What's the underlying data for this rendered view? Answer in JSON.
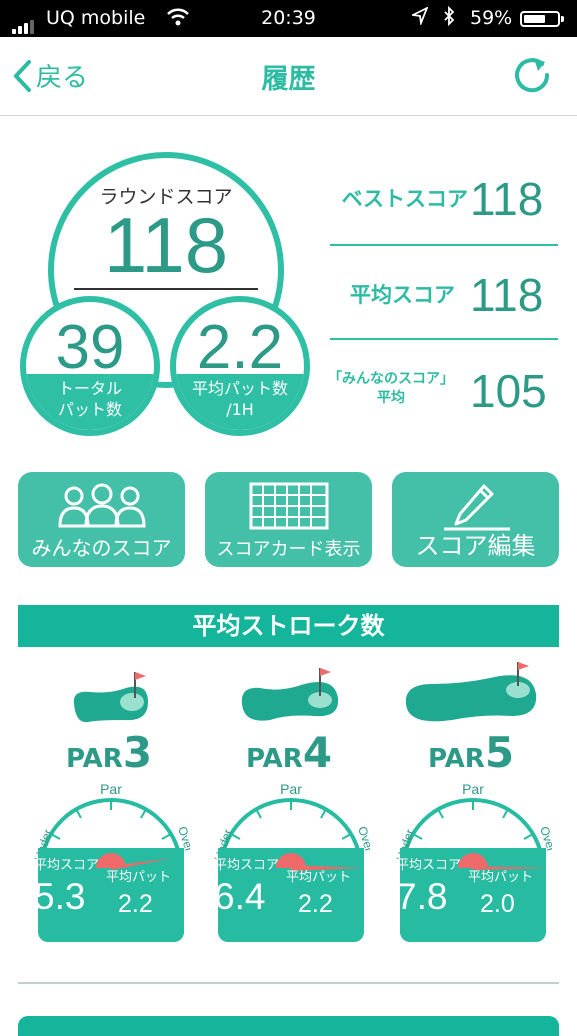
{
  "status_bar": {
    "carrier": "UQ mobile",
    "time": "20:39",
    "battery": "59%",
    "battery_level": 0.59
  },
  "nav": {
    "back_label": "戻る",
    "title": "履歴"
  },
  "round": {
    "label": "ラウンドスコア",
    "value": "118",
    "total_putts_value": "39",
    "total_putts_label_1": "トータル",
    "total_putts_label_2": "パット数",
    "avg_putts_value": "2.2",
    "avg_putts_label_1": "平均パット数",
    "avg_putts_label_2": "/1H"
  },
  "stats": {
    "best_label": "ベストスコア",
    "best_value": "118",
    "avg_label": "平均スコア",
    "avg_value": "118",
    "everyone_label_1": "「みんなのスコア」",
    "everyone_label_2": "平均",
    "everyone_value": "105"
  },
  "actions": {
    "everyone_scores": "みんなのスコア",
    "scorecard": "スコアカード表示",
    "edit_score": "スコア編集"
  },
  "section_title": "平均ストローク数",
  "pars": [
    {
      "par_text": "PAR",
      "par_num": "3",
      "gauge_top": "Par",
      "gauge_left": "Under",
      "gauge_right": "Over",
      "avg_score_label": "平均スコア",
      "avg_score": "5.3",
      "avg_putt_label": "平均パット",
      "avg_putt": "2.2"
    },
    {
      "par_text": "PAR",
      "par_num": "4",
      "gauge_top": "Par",
      "gauge_left": "Under",
      "gauge_right": "Over",
      "avg_score_label": "平均スコア",
      "avg_score": "6.4",
      "avg_putt_label": "平均パット",
      "avg_putt": "2.2"
    },
    {
      "par_text": "PAR",
      "par_num": "5",
      "gauge_top": "Par",
      "gauge_left": "Under",
      "gauge_right": "Over",
      "avg_score_label": "平均スコア",
      "avg_score": "7.8",
      "avg_putt_label": "平均パット",
      "avg_putt": "2.0"
    }
  ],
  "colors": {
    "accent": "#2dbba3",
    "accent_dark": "#2c9a86",
    "header_bg": "#14b59b",
    "needle": "#ee6a6a"
  }
}
